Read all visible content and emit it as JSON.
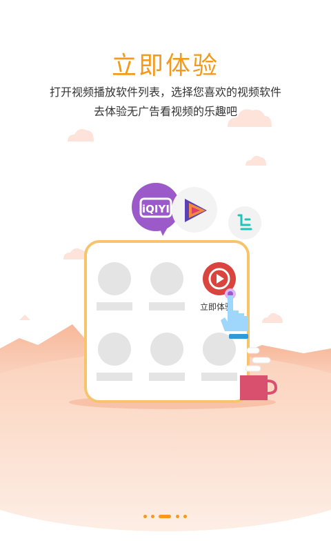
{
  "header": {
    "title": "立即体验",
    "desc_line1": "打开视频播放软件列表，选择您喜欢的视频软件",
    "desc_line2": "去体验无广告看视频的乐趣吧"
  },
  "illustration": {
    "featured_app_label": "立即体验",
    "iqiyi_logo_text": "iQIYI",
    "brand_color": "#f39a1c",
    "icons": [
      "iqiyi-icon",
      "video-play-app-icon",
      "leshi-app-icon",
      "pointing-hand-icon",
      "coffee-cup-icon"
    ]
  },
  "pager": {
    "total_pages": 5,
    "active_index": 2
  }
}
